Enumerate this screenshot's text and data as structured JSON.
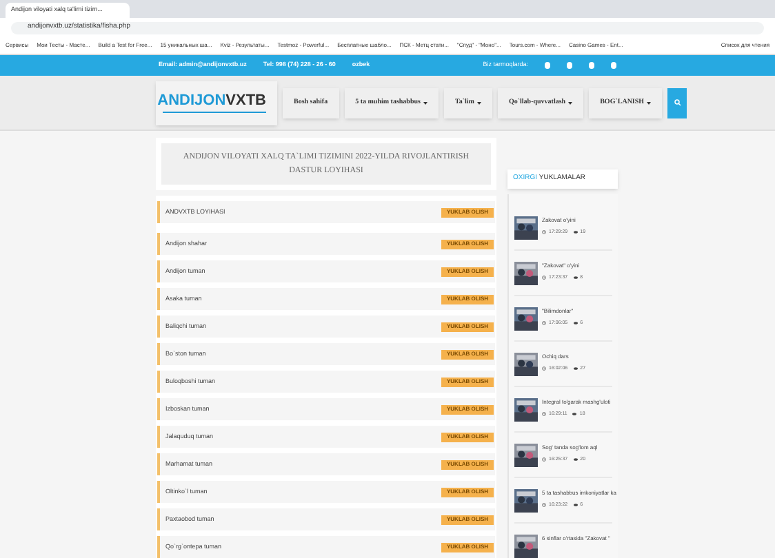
{
  "browser": {
    "tab_title": "Andijon viloyati xalq ta'limi tizim...",
    "url": "andijonvxtb.uz/statistika/fisha.php",
    "bookmarks": [
      "Сервисы",
      "Мои Тесты - Масте...",
      "Build a Test for Free...",
      "15 уникальных ша...",
      "Kviz - Результаты...",
      "Testmoz - Powerful...",
      "Бесплатные шабло...",
      "ПСК - Метц стати...",
      "\"Спуд\" - \"Моно\"...",
      "Tours.com - Where...",
      "Casino Games - Ent..."
    ],
    "reading_list": "Список для чтения"
  },
  "topbar": {
    "email": "Email: admin@andijonvxtb.uz",
    "phone": "Tel: 998 (74) 228 - 26 - 60",
    "language": "ozbek",
    "social_label": "Biz tarmoqlarda:"
  },
  "logo": {
    "name": "ANDIJON",
    "accent": "VXTB"
  },
  "nav": [
    {
      "label": "Bosh sahifa",
      "dropdown": false
    },
    {
      "label": "5 ta muhim tashabbus",
      "dropdown": true
    },
    {
      "label": "Ta`lim",
      "dropdown": true
    },
    {
      "label": "Qo`llab-quvvatlash",
      "dropdown": true
    },
    {
      "label": "BOG`LANISH",
      "dropdown": true
    }
  ],
  "page_title": "ANDIJON VILOYATI XALQ TA`LIMI TIZIMINI 2022-YILDA RIVOJLANTIRISH DASTUR LOYIHASI",
  "files": [
    {
      "name": "ANDVXTB LOYIHASI",
      "button": "YUKLAB OLISH"
    },
    {
      "name": "Andijon shahar",
      "button": "YUKLAB OLISH"
    },
    {
      "name": "Andijon tuman",
      "button": "YUKLAB OLISH"
    },
    {
      "name": "Asaka tuman",
      "button": "YUKLAB OLISH"
    },
    {
      "name": "Baliqchi tuman",
      "button": "YUKLAB OLISH"
    },
    {
      "name": "Bo`ston tuman",
      "button": "YUKLAB OLISH"
    },
    {
      "name": "Buloqboshi tuman",
      "button": "YUKLAB OLISH"
    },
    {
      "name": "Izboskan tuman",
      "button": "YUKLAB OLISH"
    },
    {
      "name": "Jalaquduq tuman",
      "button": "YUKLAB OLISH"
    },
    {
      "name": "Marhamat tuman",
      "button": "YUKLAB OLISH"
    },
    {
      "name": "Oltinko`l tuman",
      "button": "YUKLAB OLISH"
    },
    {
      "name": "Paxtaobod tuman",
      "button": "YUKLAB OLISH"
    },
    {
      "name": "Qo`rg`ontepa tuman",
      "button": "YUKLAB OLISH"
    }
  ],
  "sidebar": {
    "title_accent": "OXIRGI",
    "title": "YUKLAMALAR",
    "posts": [
      {
        "title": "Zakovat o'yini",
        "time": "17:29:29",
        "views": "19"
      },
      {
        "title": "\"Zakovat\" o'yini",
        "time": "17:23:37",
        "views": "8"
      },
      {
        "title": "\"Bilimdonlar\"",
        "time": "17:06:05",
        "views": "6"
      },
      {
        "title": "Ochiq dars",
        "time": "16:02:06",
        "views": "27"
      },
      {
        "title": "Integral to'garak mashg'uloti",
        "time": "16:29:11",
        "views": "18"
      },
      {
        "title": "Sog' tanda sog'lom aql",
        "time": "16:25:37",
        "views": "20"
      },
      {
        "title": "5 ta tashabbus imkoniyatlar ka",
        "time": "16:23:22",
        "views": "6"
      },
      {
        "title": "6 sinflar o'rtasida \"Zakovat \""
      }
    ]
  }
}
